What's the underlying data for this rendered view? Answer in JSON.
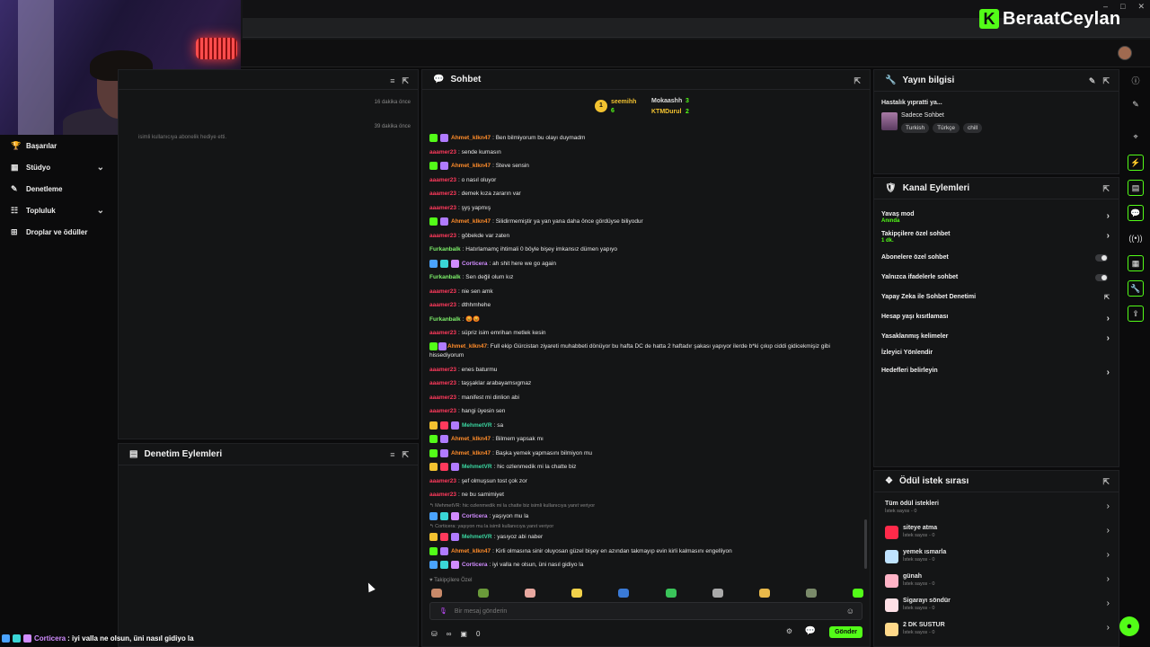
{
  "brand": {
    "logo_letter": "K",
    "name": "BeraatCeylan",
    "accent": "#53fc18"
  },
  "left_nav": {
    "items": [
      {
        "label": "Başarılar",
        "icon": "trophy-icon",
        "chevron": ""
      },
      {
        "label": "Stüdyo",
        "icon": "studio-icon",
        "chevron": "⌄"
      },
      {
        "label": "Denetleme",
        "icon": "wrench-icon",
        "chevron": ""
      },
      {
        "label": "Topluluk",
        "icon": "community-icon",
        "chevron": "⌄"
      },
      {
        "label": "Droplar ve ödüller",
        "icon": "gift-icon",
        "chevron": ""
      }
    ]
  },
  "activity_panel": {
    "rows": [
      {
        "time": "16 dakika önce"
      },
      {
        "time": "39 dakika önce"
      }
    ],
    "gift_line_tail": "isimli kullanıcıya abonelik hediye etti."
  },
  "moderation_panel": {
    "title": "Denetim Eylemleri"
  },
  "chat": {
    "title": "Sohbet",
    "leaderboard": {
      "first": {
        "name": "seemihh",
        "count": "6"
      },
      "second": {
        "name": "Mokaashh",
        "count": "3"
      },
      "third": {
        "name": "KTMDurul",
        "count": "2"
      }
    },
    "messages": [
      {
        "user": "Ahmet_klkn47",
        "color": "#ff8c2a",
        "badges": [
          "#53fc18",
          "#b07bff"
        ],
        "text": ": Ben bilmiyorum bu olayı duymadm"
      },
      {
        "user": "aaamer23",
        "color": "#ff3a5c",
        "badges": [],
        "text": ": sende kumasın"
      },
      {
        "user": "Ahmet_klkn47",
        "color": "#ff8c2a",
        "badges": [
          "#53fc18",
          "#b07bff"
        ],
        "text": ": Steve sensin"
      },
      {
        "user": "aaamer23",
        "color": "#ff3a5c",
        "badges": [],
        "text": ": o nasıl oluyor"
      },
      {
        "user": "aaamer23",
        "color": "#ff3a5c",
        "badges": [],
        "text": ": demek kıza zararın var"
      },
      {
        "user": "aaamer23",
        "color": "#ff3a5c",
        "badges": [],
        "text": ": şyş yapmış"
      },
      {
        "user": "Ahmet_klkn47",
        "color": "#ff8c2a",
        "badges": [
          "#53fc18",
          "#b07bff"
        ],
        "text": ": Silidirmemiştir ya yan yana daha önce gördüyse biliyodur"
      },
      {
        "user": "aaamer23",
        "color": "#ff3a5c",
        "badges": [],
        "text": ": göbekde var zaten"
      },
      {
        "user": "Furkanbalk",
        "color": "#7df06a",
        "badges": [],
        "text": ": Hatırlamamç ihtimali 0 böyle bişey imkansız dümen yapıyo"
      },
      {
        "user": "Corticera",
        "color": "#d18cff",
        "badges": [
          "#4aa3ff",
          "#3ad6d6",
          "#d18cff"
        ],
        "text": ": ah shit here we go again"
      },
      {
        "user": "Furkanbalk",
        "color": "#7df06a",
        "badges": [],
        "text": ": Sen değil olum kız"
      },
      {
        "user": "aaamer23",
        "color": "#ff3a5c",
        "badges": [],
        "text": ": nie sen amk"
      },
      {
        "user": "aaamer23",
        "color": "#ff3a5c",
        "badges": [],
        "text": ": dthhmhehe"
      },
      {
        "user": "Furkanbalk",
        "color": "#7df06a",
        "badges": [],
        "text": ": 😡😡"
      },
      {
        "user": "aaamer23",
        "color": "#ff3a5c",
        "badges": [],
        "text": ": süpriz isim emrihan metlek kesin"
      },
      {
        "user": "Ahmet_klkn47",
        "color": "#ff8c2a",
        "badges": [
          "#53fc18",
          "#b07bff"
        ],
        "text": ": Full ekip Gürcistan ziyareti muhabbeti dönüyor bu hafta DC de hatta 2 haftadır şakası yapıyor ilerde b*ki çıkıp ciddi gidicekmişiz gibi hissediyorum",
        "wrap": true
      },
      {
        "user": "aaamer23",
        "color": "#ff3a5c",
        "badges": [],
        "text": ": enes baturmu"
      },
      {
        "user": "aaamer23",
        "color": "#ff3a5c",
        "badges": [],
        "text": ": taşşaklar arabayamsıgmaz"
      },
      {
        "user": "aaamer23",
        "color": "#ff3a5c",
        "badges": [],
        "text": ": manifest mi dinlion abi"
      },
      {
        "user": "aaamer23",
        "color": "#ff3a5c",
        "badges": [],
        "text": ": hangi üyesin sen"
      },
      {
        "user": "MehmetVR",
        "color": "#3ad6a0",
        "badges": [
          "#f2c230",
          "#ff3a5c",
          "#b07bff"
        ],
        "text": ": sa"
      },
      {
        "user": "Ahmet_klkn47",
        "color": "#ff8c2a",
        "badges": [
          "#53fc18",
          "#b07bff"
        ],
        "text": ": Bilmem yapsak mı"
      },
      {
        "user": "Ahmet_klkn47",
        "color": "#ff8c2a",
        "badges": [
          "#53fc18",
          "#b07bff"
        ],
        "text": ": Başka yemek yapmasını bilmiyon mu"
      },
      {
        "user": "MehmetVR",
        "color": "#3ad6a0",
        "badges": [
          "#f2c230",
          "#ff3a5c",
          "#b07bff"
        ],
        "text": ": hic ozlenmedik mi la chatte biz"
      },
      {
        "user": "aaamer23",
        "color": "#ff3a5c",
        "badges": [],
        "text": ": şef olmuşsun tost çok zor"
      },
      {
        "user": "aaamer23",
        "color": "#ff3a5c",
        "badges": [],
        "text": ": ne bu samimiyet"
      },
      {
        "reply": "↰ MehmetVR: hic ozlenmedik mi la chatte biz isimli kullanıcıya yanıt veriyor"
      },
      {
        "user": "Corticera",
        "color": "#d18cff",
        "badges": [
          "#4aa3ff",
          "#3ad6d6",
          "#d18cff"
        ],
        "text": ": yaşıyon mu la"
      },
      {
        "reply": "↰ Corticera: yaşıyon mu la isimli kullanıcıya yanıt veriyor"
      },
      {
        "user": "MehmetVR",
        "color": "#3ad6a0",
        "badges": [
          "#f2c230",
          "#ff3a5c",
          "#b07bff"
        ],
        "text": ": yasıyoz abi naber"
      },
      {
        "user": "Ahmet_klkn47",
        "color": "#ff8c2a",
        "badges": [
          "#53fc18",
          "#b07bff"
        ],
        "text": ": Kirli olmasına sinir oluyosan güzel bişey en azından takmayıp evin kirli kalmasını engelliyon"
      },
      {
        "user": "Corticera",
        "color": "#d18cff",
        "badges": [
          "#4aa3ff",
          "#3ad6d6",
          "#d18cff"
        ],
        "text": ": iyi valla ne olsun, üni nasıl gidiyo la"
      }
    ],
    "followers_only": "♥ Takipçilere Özel",
    "emote_colors": [
      "#c98a6a",
      "#6a9a3a",
      "#e8a8a0",
      "#f2d24a",
      "#3a7ad6",
      "#3ac45a",
      "#aaa",
      "#e8b84a",
      "#7a8a6a",
      "#53fc18"
    ],
    "input_placeholder": "Bir mesaj gönderin",
    "footer_infinity": "∞",
    "footer_count": "0",
    "send_label": "Gönder"
  },
  "stream_info": {
    "title": "Yayın bilgisi",
    "stream_title": "Hastalık yıpratti ya...",
    "category": "Sadece Sohbet",
    "tags": [
      "Turkish",
      "Türkçe",
      "chill"
    ]
  },
  "channel_actions": {
    "title": "Kanal Eylemleri",
    "rows": [
      {
        "label": "Yavaş mod",
        "sub": "Anında",
        "control": "arrow"
      },
      {
        "label": "Takipçilere özel sohbet",
        "sub": "1 dk.",
        "control": "arrow"
      },
      {
        "label": "Abonelere özel sohbet",
        "sub": "",
        "control": "toggle"
      },
      {
        "label": "Yalnızca ifadelerle sohbet",
        "sub": "",
        "control": "toggle"
      },
      {
        "label": "Yapay Zeka ile Sohbet Denetimi",
        "sub": "",
        "control": "external"
      },
      {
        "label": "Hesap yaşı kısıtlaması",
        "sub": "",
        "control": "arrow"
      },
      {
        "label": "Yasaklanmış kelimeler",
        "sub": "",
        "control": "arrow"
      },
      {
        "label": "İzleyici Yönlendir",
        "sub": "",
        "control": "none"
      },
      {
        "label": "Hedefleri belirleyin",
        "sub": "",
        "control": "arrow"
      }
    ]
  },
  "rewards_queue": {
    "title": "Ödül istek sırası",
    "all": {
      "label": "Tüm ödül istekleri",
      "count": "İstek sayısı - 0"
    },
    "items": [
      {
        "label": "siteye atma",
        "count": "İstek sayısı - 0",
        "color": "#ff2a4a"
      },
      {
        "label": "yemek ısmarla",
        "count": "İstek sayısı - 0",
        "color": "#bfe3ff"
      },
      {
        "label": "günah",
        "count": "İstek sayısı - 0",
        "color": "#ffb3c6"
      },
      {
        "label": "Sigarayı söndür",
        "count": "İstek sayısı - 0",
        "color": "#ffe0e6"
      },
      {
        "label": "2 DK SUSTUR",
        "count": "İstek sayısı - 0",
        "color": "#ffd98a"
      }
    ]
  },
  "overlay_chat": {
    "user": "Corticera",
    "text": " : iyi valla ne olsun, üni nasıl gidiyo la"
  }
}
